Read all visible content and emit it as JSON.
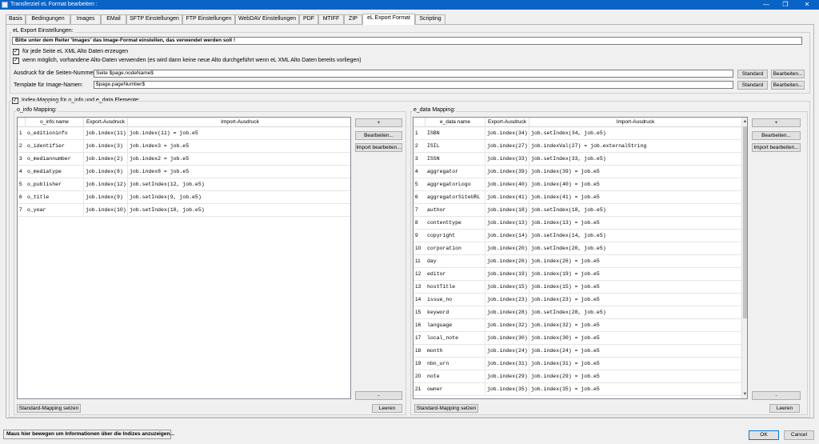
{
  "window": {
    "title": "Transferziel eL Format bearbeiten :",
    "minimize_glyph": "—",
    "maximize_glyph": "❐",
    "close_glyph": "✕"
  },
  "tabs": [
    {
      "label": "Basis"
    },
    {
      "label": "Bedingungen"
    },
    {
      "label": "Images"
    },
    {
      "label": "EMail"
    },
    {
      "label": "SFTP Einstellungen"
    },
    {
      "label": "FTP Einstellungen"
    },
    {
      "label": "WebDAV Einstellungen"
    },
    {
      "label": "PDF"
    },
    {
      "label": "MTIFF"
    },
    {
      "label": "ZIP"
    },
    {
      "label": "eL Export Format"
    },
    {
      "label": "Scripting"
    }
  ],
  "active_tab": "eL Export Format",
  "settings": {
    "group_title": "eL Export Einstellungen:",
    "notice": "Bitte unter dem Reiter 'Images' das Image-Format einstellen, das verwendet werden soll !",
    "chk_alto_label": "für jede Seite eL XML Alto Daten erzeugen",
    "chk_existing_label": "wenn möglich, vorhandene Alto-Daten verwenden (es wird dann keine neue Alto durchgeführt wenn eL XML Alto Daten bereits vorliegen)",
    "page_number_label": "Ausdruck für die Seiten-Nummer:",
    "page_number_value": "Seite $page.nodeName$",
    "image_name_label": "Template für Image-Namen:",
    "image_name_value": "$page.pageNumber$",
    "standard_label": "Standard",
    "edit_label": "Bearbeiten..."
  },
  "index_mapping_label": "Index-Mapping für o_info und e_data Elemente:",
  "o_info": {
    "group_title": "o_info Mapping:",
    "headers": [
      "o_info name",
      "Export-Ausdruck",
      "Import-Ausdruck"
    ],
    "rows": [
      {
        "n": "1",
        "name": "o_editioninfo",
        "export": "job.index(11)",
        "import": "job.index(11) = job.e5"
      },
      {
        "n": "2",
        "name": "o_identifier",
        "export": "job.index(3)",
        "import": "job.index3 = job.e5"
      },
      {
        "n": "3",
        "name": "o_mediannumber",
        "export": "job.index(2)",
        "import": "job.index2 = job.e5"
      },
      {
        "n": "4",
        "name": "o_mediatype",
        "export": "job.index(8)",
        "import": "job.index8 = job.e5"
      },
      {
        "n": "5",
        "name": "o_publisher",
        "export": "job.index(12)",
        "import": "job.setIndex(12, job.e5)"
      },
      {
        "n": "6",
        "name": "o_title",
        "export": "job.index(9)",
        "import": "job.setIndex(9, job.e5)"
      },
      {
        "n": "7",
        "name": "o_year",
        "export": "job.index(10)",
        "import": "job.setIndex(10, job.e5)"
      }
    ],
    "add_label": "+",
    "edit_label": "Bearbeiten...",
    "edit_import_label": "Import bearbeiten...",
    "remove_label": "-",
    "standard_mapping_label": "Standard-Mapping setzen",
    "clear_label": "Leeren"
  },
  "e_data": {
    "group_title": "e_data Mapping:",
    "headers": [
      "e_data name",
      "Export-Ausdruck",
      "Import-Ausdruck"
    ],
    "rows": [
      {
        "n": "1",
        "name": "ISBN",
        "export": "job.index(34)",
        "import": "job.setIndex(34, job.e5)"
      },
      {
        "n": "2",
        "name": "ISIL",
        "export": "job.index(27)",
        "import": "job.indexVal(27) = job.externalString"
      },
      {
        "n": "3",
        "name": "ISSN",
        "export": "job.index(33)",
        "import": "job.setIndex(33, job.e5)"
      },
      {
        "n": "4",
        "name": "aggregator",
        "export": "job.index(39)",
        "import": "job.index(39) = job.e5"
      },
      {
        "n": "5",
        "name": "aggregatorLogo",
        "export": "job.index(40)",
        "import": "job.index(40) = job.e5"
      },
      {
        "n": "6",
        "name": "aggregatorSiteURL",
        "export": "job.index(41)",
        "import": "job.index(41) = job.e5"
      },
      {
        "n": "7",
        "name": "author",
        "export": "job.index(18)",
        "import": "job.setIndex(18, job.e5)"
      },
      {
        "n": "8",
        "name": "contenttype",
        "export": "job.index(13)",
        "import": "job.index(13) = job.e5"
      },
      {
        "n": "9",
        "name": "copyright",
        "export": "job.index(14)",
        "import": "job.setIndex(14, job.e5)"
      },
      {
        "n": "10",
        "name": "corporation",
        "export": "job.index(20)",
        "import": "job.setIndex(20, job.e5)"
      },
      {
        "n": "11",
        "name": "day",
        "export": "job.index(26)",
        "import": "job.index(26) = job.e5"
      },
      {
        "n": "12",
        "name": "editor",
        "export": "job.index(19)",
        "import": "job.index(19) = job.e5"
      },
      {
        "n": "13",
        "name": "hostTitle",
        "export": "job.index(15)",
        "import": "job.index(15) = job.e5"
      },
      {
        "n": "14",
        "name": "issue_no",
        "export": "job.index(23)",
        "import": "job.index(23) = job.e5"
      },
      {
        "n": "15",
        "name": "keyword",
        "export": "job.index(28)",
        "import": "job.setIndex(28, job.e5)"
      },
      {
        "n": "16",
        "name": "language",
        "export": "job.index(32)",
        "import": "job.index(32) = job.e5"
      },
      {
        "n": "17",
        "name": "local_note",
        "export": "job.index(30)",
        "import": "job.index(30) = job.e5"
      },
      {
        "n": "18",
        "name": "month",
        "export": "job.index(24)",
        "import": "job.index(24) = job.e5"
      },
      {
        "n": "19",
        "name": "nbn_urn",
        "export": "job.index(31)",
        "import": "job.index(31) = job.e5"
      },
      {
        "n": "20",
        "name": "note",
        "export": "job.index(29)",
        "import": "job.index(29) = job.e5"
      },
      {
        "n": "21",
        "name": "owner",
        "export": "job.index(35)",
        "import": "job.index(35) = job.e5"
      }
    ],
    "add_label": "+",
    "edit_label": "Bearbeiten...",
    "edit_import_label": "Import bearbeiten...",
    "remove_label": "-",
    "standard_mapping_label": "Standard-Mapping setzen",
    "clear_label": "Leeren",
    "scroll_up_glyph": "▲",
    "scroll_down_glyph": "▼"
  },
  "status": "Maus hier bewegen um Informationen über die Indizes anzuzeigen...",
  "ok_label": "OK",
  "cancel_label": "Cancel"
}
